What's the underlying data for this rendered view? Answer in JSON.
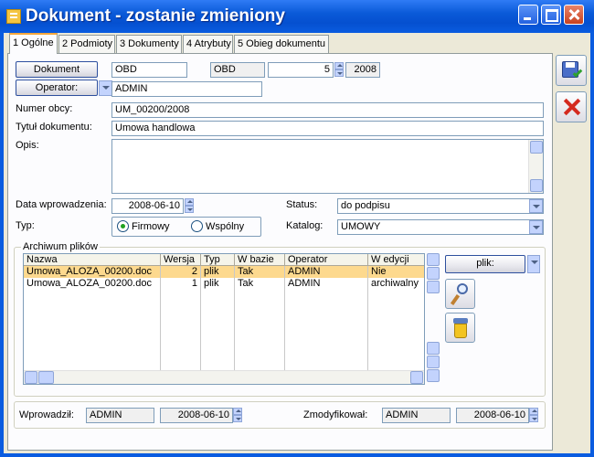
{
  "window": {
    "title": "Dokument - zostanie zmieniony"
  },
  "tabs": [
    {
      "label": "1 Ogólne"
    },
    {
      "label": "2 Podmioty"
    },
    {
      "label": "3 Dokumenty"
    },
    {
      "label": "4 Atrybuty"
    },
    {
      "label": "5 Obieg dokumentu"
    }
  ],
  "document": {
    "button_label": "Dokument",
    "type_symbol": "OBD",
    "type_code": "OBD",
    "number": "5",
    "year": "2008"
  },
  "operator": {
    "button_label": "Operator:",
    "value": "ADMIN"
  },
  "fields": {
    "numer_obcy_label": "Numer obcy:",
    "numer_obcy": "UM_00200/2008",
    "tytul_label": "Tytuł dokumentu:",
    "tytul": "Umowa handlowa",
    "opis_label": "Opis:",
    "opis": "",
    "data_label": "Data wprowadzenia:",
    "data": "2008-06-10",
    "status_label": "Status:",
    "status": "do podpisu",
    "typ_label": "Typ:",
    "typ_firmowy": "Firmowy",
    "typ_wspolny": "Wspólny",
    "katalog_label": "Katalog:",
    "katalog": "UMOWY"
  },
  "archive": {
    "group_label": "Archiwum plików",
    "columns": [
      "Nazwa",
      "Wersja",
      "Typ",
      "W bazie",
      "Operator",
      "W edycji"
    ],
    "rows": [
      {
        "nazwa": "Umowa_ALOZA_00200.doc",
        "wersja": "2",
        "typ": "plik",
        "w_bazie": "Tak",
        "operator": "ADMIN",
        "w_edycji": "Nie"
      },
      {
        "nazwa": "Umowa_ALOZA_00200.doc",
        "wersja": "1",
        "typ": "plik",
        "w_bazie": "Tak",
        "operator": "ADMIN",
        "w_edycji": "archiwalny"
      }
    ],
    "plik_button": "plik:"
  },
  "footer": {
    "wprowadzil_label": "Wprowadził:",
    "wprowadzil_user": "ADMIN",
    "wprowadzil_date": "2008-06-10",
    "zmodyfikowal_label": "Zmodyfikował:",
    "zmodyfikowal_user": "ADMIN",
    "zmodyfikowal_date": "2008-06-10"
  }
}
